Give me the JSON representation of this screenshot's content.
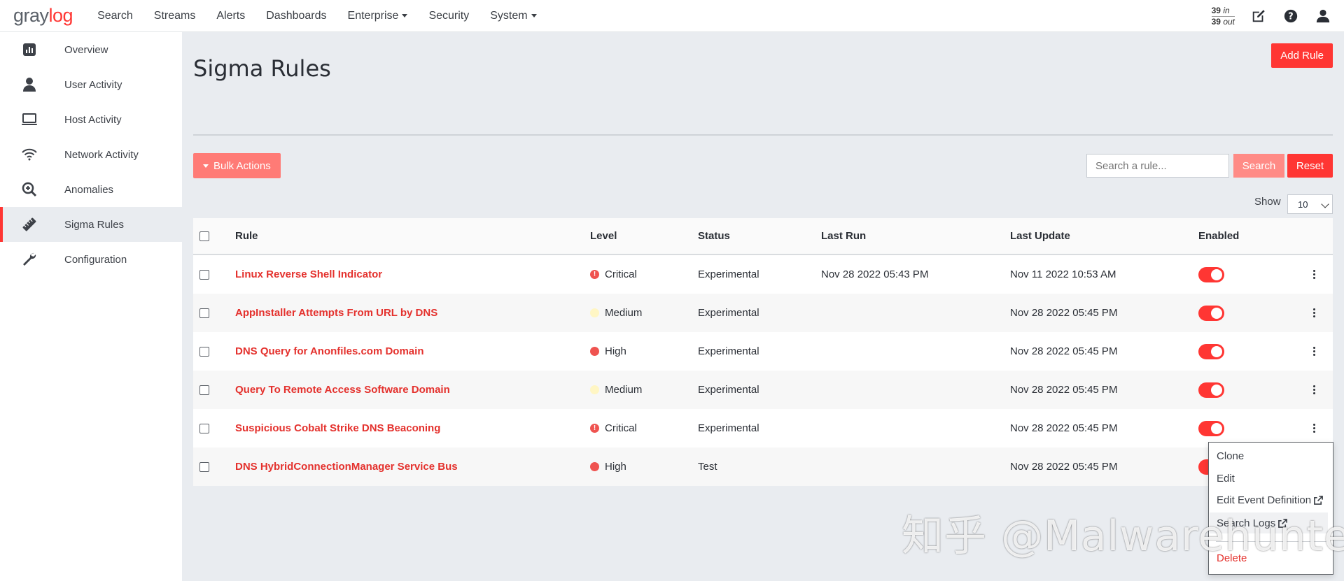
{
  "app": {
    "logo_prefix": "gray",
    "logo_accent": "log"
  },
  "nav": {
    "items": [
      "Search",
      "Streams",
      "Alerts",
      "Dashboards",
      "Enterprise",
      "Security",
      "System"
    ],
    "dropdown_items": [
      "Enterprise",
      "System"
    ],
    "throughput": {
      "in_value": "39",
      "in_label": "in",
      "out_value": "39",
      "out_label": "out"
    },
    "icons": [
      "edit-icon",
      "help-icon",
      "user-icon"
    ]
  },
  "sidebar": {
    "items": [
      {
        "label": "Overview",
        "icon": "chart-icon"
      },
      {
        "label": "User Activity",
        "icon": "user-icon"
      },
      {
        "label": "Host Activity",
        "icon": "monitor-icon"
      },
      {
        "label": "Network Activity",
        "icon": "wifi-icon"
      },
      {
        "label": "Anomalies",
        "icon": "zoom-in-icon"
      },
      {
        "label": "Sigma Rules",
        "icon": "ruler-icon",
        "active": true
      },
      {
        "label": "Configuration",
        "icon": "wrench-icon"
      }
    ]
  },
  "page": {
    "title": "Sigma Rules",
    "add_rule_label": "Add Rule",
    "bulk_actions_label": "Bulk Actions",
    "search_placeholder": "Search a rule...",
    "search_label": "Search",
    "reset_label": "Reset",
    "show_label": "Show",
    "show_value": "10"
  },
  "table": {
    "columns": [
      "Rule",
      "Level",
      "Status",
      "Last Run",
      "Last Update",
      "Enabled"
    ],
    "rows": [
      {
        "rule": "Linux Reverse Shell Indicator",
        "level": "Critical",
        "status": "Experimental",
        "last_run": "Nov 28 2022 05:43 PM",
        "last_update": "Nov 11 2022 10:53 AM",
        "enabled": true
      },
      {
        "rule": "AppInstaller Attempts From URL by DNS",
        "level": "Medium",
        "status": "Experimental",
        "last_run": "",
        "last_update": "Nov 28 2022 05:45 PM",
        "enabled": true
      },
      {
        "rule": "DNS Query for Anonfiles.com Domain",
        "level": "High",
        "status": "Experimental",
        "last_run": "",
        "last_update": "Nov 28 2022 05:45 PM",
        "enabled": true
      },
      {
        "rule": "Query To Remote Access Software Domain",
        "level": "Medium",
        "status": "Experimental",
        "last_run": "",
        "last_update": "Nov 28 2022 05:45 PM",
        "enabled": true
      },
      {
        "rule": "Suspicious Cobalt Strike DNS Beaconing",
        "level": "Critical",
        "status": "Experimental",
        "last_run": "",
        "last_update": "Nov 28 2022 05:45 PM",
        "enabled": true
      },
      {
        "rule": "DNS HybridConnectionManager Service Bus",
        "level": "High",
        "status": "Test",
        "last_run": "",
        "last_update": "Nov 28 2022 05:45 PM",
        "enabled": true
      }
    ]
  },
  "row_menu": {
    "items": [
      "Clone",
      "Edit",
      "Edit Event Definition",
      "Search Logs",
      "Delete"
    ]
  },
  "watermark": "知乎 @Malwarehunter",
  "colors": {
    "accent": "#ff3633",
    "link": "#e4312d",
    "critical": "#ef5350",
    "medium": "#fff6c4"
  }
}
